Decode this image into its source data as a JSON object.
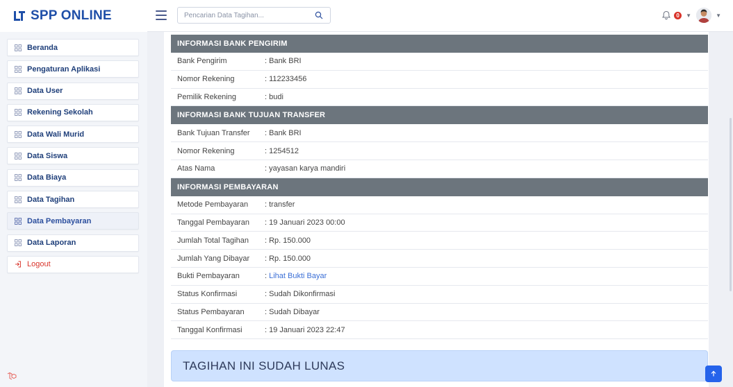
{
  "app": {
    "brand": "SPP ONLINE"
  },
  "search": {
    "placeholder": "Pencarian Data Tagihan..."
  },
  "header": {
    "notification_count": "0"
  },
  "sidebar": {
    "items": [
      {
        "label": "Beranda"
      },
      {
        "label": "Pengaturan Aplikasi"
      },
      {
        "label": "Data User"
      },
      {
        "label": "Rekening Sekolah"
      },
      {
        "label": "Data Wali Murid"
      },
      {
        "label": "Data Siswa"
      },
      {
        "label": "Data Biaya"
      },
      {
        "label": "Data Tagihan"
      },
      {
        "label": "Data Pembayaran"
      },
      {
        "label": "Data Laporan"
      }
    ],
    "logout": "Logout",
    "active_item": "Data Pembayaran"
  },
  "detail": {
    "bank_pengirim": {
      "title": "INFORMASI BANK PENGIRIM",
      "rows": [
        {
          "key": "Bank Pengirim",
          "value": ": Bank BRI"
        },
        {
          "key": "Nomor Rekening",
          "value": ": 112233456"
        },
        {
          "key": "Pemilik Rekening",
          "value": ": budi"
        }
      ]
    },
    "bank_tujuan": {
      "title": "INFORMASI BANK TUJUAN TRANSFER",
      "rows": [
        {
          "key": "Bank Tujuan Transfer",
          "value": ": Bank BRI"
        },
        {
          "key": "Nomor Rekening",
          "value": ": 1254512"
        },
        {
          "key": "Atas Nama",
          "value": ": yayasan karya mandiri"
        }
      ]
    },
    "pembayaran": {
      "title": "INFORMASI PEMBAYARAN",
      "rows": [
        {
          "key": "Metode Pembayaran",
          "value": ": transfer"
        },
        {
          "key": "Tanggal Pembayaran",
          "value": ": 19 Januari 2023 00:00"
        },
        {
          "key": "Jumlah Total Tagihan",
          "value": ": Rp. 150.000"
        },
        {
          "key": "Jumlah Yang Dibayar",
          "value": ": Rp. 150.000"
        },
        {
          "key": "Bukti Pembayaran",
          "value_prefix": ": ",
          "link": "Lihat Bukti Bayar"
        },
        {
          "key": "Status Konfirmasi",
          "value": ": Sudah Dikonfirmasi"
        },
        {
          "key": "Status Pembayaran",
          "value": ": Sudah Dibayar"
        },
        {
          "key": "Tanggal Konfirmasi",
          "value": ": 19 Januari 2023 22:47"
        }
      ]
    }
  },
  "status_banner": "TAGIHAN INI SUDAH LUNAS",
  "icons": {
    "brand": "logo-icon",
    "menu": "hamburger-icon",
    "search": "search-icon",
    "bell": "bell-icon",
    "menu_item": "grid-icon",
    "logout": "logout-icon",
    "scroll_top": "arrow-up-icon"
  },
  "colors": {
    "brand": "#1f4fa8",
    "section_header": "#6c757d",
    "banner_bg": "#cfe2ff",
    "link": "#3b6fd6",
    "badge": "#d9342b",
    "scroll_top": "#2563eb"
  }
}
